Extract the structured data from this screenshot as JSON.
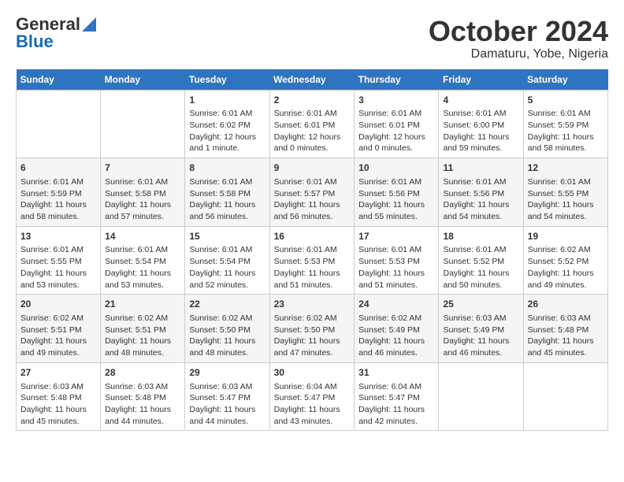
{
  "header": {
    "logo_general": "General",
    "logo_blue": "Blue",
    "month": "October 2024",
    "location": "Damaturu, Yobe, Nigeria"
  },
  "weekdays": [
    "Sunday",
    "Monday",
    "Tuesday",
    "Wednesday",
    "Thursday",
    "Friday",
    "Saturday"
  ],
  "weeks": [
    [
      {
        "day": "",
        "info": ""
      },
      {
        "day": "",
        "info": ""
      },
      {
        "day": "1",
        "info": "Sunrise: 6:01 AM\nSunset: 6:02 PM\nDaylight: 12 hours and 1 minute."
      },
      {
        "day": "2",
        "info": "Sunrise: 6:01 AM\nSunset: 6:01 PM\nDaylight: 12 hours and 0 minutes."
      },
      {
        "day": "3",
        "info": "Sunrise: 6:01 AM\nSunset: 6:01 PM\nDaylight: 12 hours and 0 minutes."
      },
      {
        "day": "4",
        "info": "Sunrise: 6:01 AM\nSunset: 6:00 PM\nDaylight: 11 hours and 59 minutes."
      },
      {
        "day": "5",
        "info": "Sunrise: 6:01 AM\nSunset: 5:59 PM\nDaylight: 11 hours and 58 minutes."
      }
    ],
    [
      {
        "day": "6",
        "info": "Sunrise: 6:01 AM\nSunset: 5:59 PM\nDaylight: 11 hours and 58 minutes."
      },
      {
        "day": "7",
        "info": "Sunrise: 6:01 AM\nSunset: 5:58 PM\nDaylight: 11 hours and 57 minutes."
      },
      {
        "day": "8",
        "info": "Sunrise: 6:01 AM\nSunset: 5:58 PM\nDaylight: 11 hours and 56 minutes."
      },
      {
        "day": "9",
        "info": "Sunrise: 6:01 AM\nSunset: 5:57 PM\nDaylight: 11 hours and 56 minutes."
      },
      {
        "day": "10",
        "info": "Sunrise: 6:01 AM\nSunset: 5:56 PM\nDaylight: 11 hours and 55 minutes."
      },
      {
        "day": "11",
        "info": "Sunrise: 6:01 AM\nSunset: 5:56 PM\nDaylight: 11 hours and 54 minutes."
      },
      {
        "day": "12",
        "info": "Sunrise: 6:01 AM\nSunset: 5:55 PM\nDaylight: 11 hours and 54 minutes."
      }
    ],
    [
      {
        "day": "13",
        "info": "Sunrise: 6:01 AM\nSunset: 5:55 PM\nDaylight: 11 hours and 53 minutes."
      },
      {
        "day": "14",
        "info": "Sunrise: 6:01 AM\nSunset: 5:54 PM\nDaylight: 11 hours and 53 minutes."
      },
      {
        "day": "15",
        "info": "Sunrise: 6:01 AM\nSunset: 5:54 PM\nDaylight: 11 hours and 52 minutes."
      },
      {
        "day": "16",
        "info": "Sunrise: 6:01 AM\nSunset: 5:53 PM\nDaylight: 11 hours and 51 minutes."
      },
      {
        "day": "17",
        "info": "Sunrise: 6:01 AM\nSunset: 5:53 PM\nDaylight: 11 hours and 51 minutes."
      },
      {
        "day": "18",
        "info": "Sunrise: 6:01 AM\nSunset: 5:52 PM\nDaylight: 11 hours and 50 minutes."
      },
      {
        "day": "19",
        "info": "Sunrise: 6:02 AM\nSunset: 5:52 PM\nDaylight: 11 hours and 49 minutes."
      }
    ],
    [
      {
        "day": "20",
        "info": "Sunrise: 6:02 AM\nSunset: 5:51 PM\nDaylight: 11 hours and 49 minutes."
      },
      {
        "day": "21",
        "info": "Sunrise: 6:02 AM\nSunset: 5:51 PM\nDaylight: 11 hours and 48 minutes."
      },
      {
        "day": "22",
        "info": "Sunrise: 6:02 AM\nSunset: 5:50 PM\nDaylight: 11 hours and 48 minutes."
      },
      {
        "day": "23",
        "info": "Sunrise: 6:02 AM\nSunset: 5:50 PM\nDaylight: 11 hours and 47 minutes."
      },
      {
        "day": "24",
        "info": "Sunrise: 6:02 AM\nSunset: 5:49 PM\nDaylight: 11 hours and 46 minutes."
      },
      {
        "day": "25",
        "info": "Sunrise: 6:03 AM\nSunset: 5:49 PM\nDaylight: 11 hours and 46 minutes."
      },
      {
        "day": "26",
        "info": "Sunrise: 6:03 AM\nSunset: 5:48 PM\nDaylight: 11 hours and 45 minutes."
      }
    ],
    [
      {
        "day": "27",
        "info": "Sunrise: 6:03 AM\nSunset: 5:48 PM\nDaylight: 11 hours and 45 minutes."
      },
      {
        "day": "28",
        "info": "Sunrise: 6:03 AM\nSunset: 5:48 PM\nDaylight: 11 hours and 44 minutes."
      },
      {
        "day": "29",
        "info": "Sunrise: 6:03 AM\nSunset: 5:47 PM\nDaylight: 11 hours and 44 minutes."
      },
      {
        "day": "30",
        "info": "Sunrise: 6:04 AM\nSunset: 5:47 PM\nDaylight: 11 hours and 43 minutes."
      },
      {
        "day": "31",
        "info": "Sunrise: 6:04 AM\nSunset: 5:47 PM\nDaylight: 11 hours and 42 minutes."
      },
      {
        "day": "",
        "info": ""
      },
      {
        "day": "",
        "info": ""
      }
    ]
  ]
}
